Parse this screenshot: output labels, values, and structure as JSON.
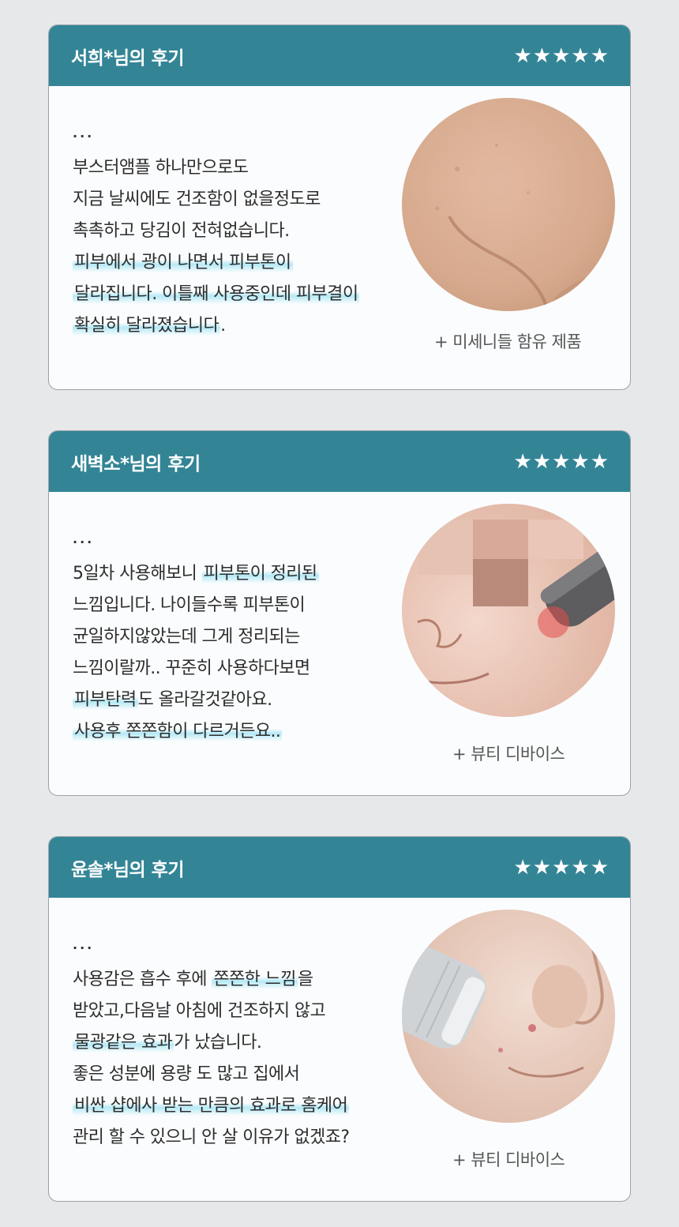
{
  "reviews": [
    {
      "title": "서희*님의 후기",
      "stars": [
        "★",
        "★",
        "★",
        "★",
        "★"
      ],
      "dots": "...",
      "lines": [
        [
          {
            "t": "부스터앰플 하나만으로도"
          }
        ],
        [
          {
            "t": "지금 날씨에도 건조함이 없을정도로"
          }
        ],
        [
          {
            "t": "촉촉하고 당김이 전혀없습니다."
          }
        ],
        [
          {
            "t": "피부에서 광이 나면서 피부톤이",
            "hl": true
          }
        ],
        [
          {
            "t": "달라집니다. 이틀째 사용중인데 피부결이",
            "hl": true
          }
        ],
        [
          {
            "t": "확실히 달라졌습니다",
            "hl": true
          },
          {
            "t": "."
          }
        ]
      ],
      "caption": "+ 미세니들 함유 제품",
      "photo_icon": "skin-cheek-photo"
    },
    {
      "title": "새벽소*님의 후기",
      "stars": [
        "★",
        "★",
        "★",
        "★",
        "★"
      ],
      "dots": "...",
      "lines": [
        [
          {
            "t": "5일차 사용해보니 "
          },
          {
            "t": "피부톤이 정리된",
            "hl": true
          }
        ],
        [
          {
            "t": "느낌입니다. 나이들수록 피부톤이"
          }
        ],
        [
          {
            "t": "균일하지않았는데 그게 정리되는"
          }
        ],
        [
          {
            "t": "느낌이랄까.. 꾸준히 사용하다보면"
          }
        ],
        [
          {
            "t": "피부탄력",
            "hl": true
          },
          {
            "t": "도 올라갈것같아요."
          }
        ],
        [
          {
            "t": "사용후 쫀쫀함이 다르거든요..",
            "hl": true
          }
        ]
      ],
      "caption": "+ 뷰티 디바이스",
      "photo_icon": "beauty-device-photo"
    },
    {
      "title": "윤솔*님의 후기",
      "stars": [
        "★",
        "★",
        "★",
        "★",
        "★"
      ],
      "dots": "...",
      "lines": [
        [
          {
            "t": "사용감은 흡수 후에 "
          },
          {
            "t": "쫀쫀한 느낌",
            "hl": true
          },
          {
            "t": "을"
          }
        ],
        [
          {
            "t": "받았고,다음날 아침에 건조하지 않고"
          }
        ],
        [
          {
            "t": "물광같은 효과",
            "hl": true
          },
          {
            "t": "가 났습니다."
          }
        ],
        [
          {
            "t": "좋은 성분에 용량 도 많고 집에서"
          }
        ],
        [
          {
            "t": "비싼 샵에사 받는 만큼의 효과로 홈케어",
            "hl": true
          }
        ],
        [
          {
            "t": "관리 할 수 있으니 안 살 이유가 없겠죠?"
          }
        ]
      ],
      "caption": "+ 뷰티 디바이스",
      "photo_icon": "beauty-device-photo"
    }
  ]
}
